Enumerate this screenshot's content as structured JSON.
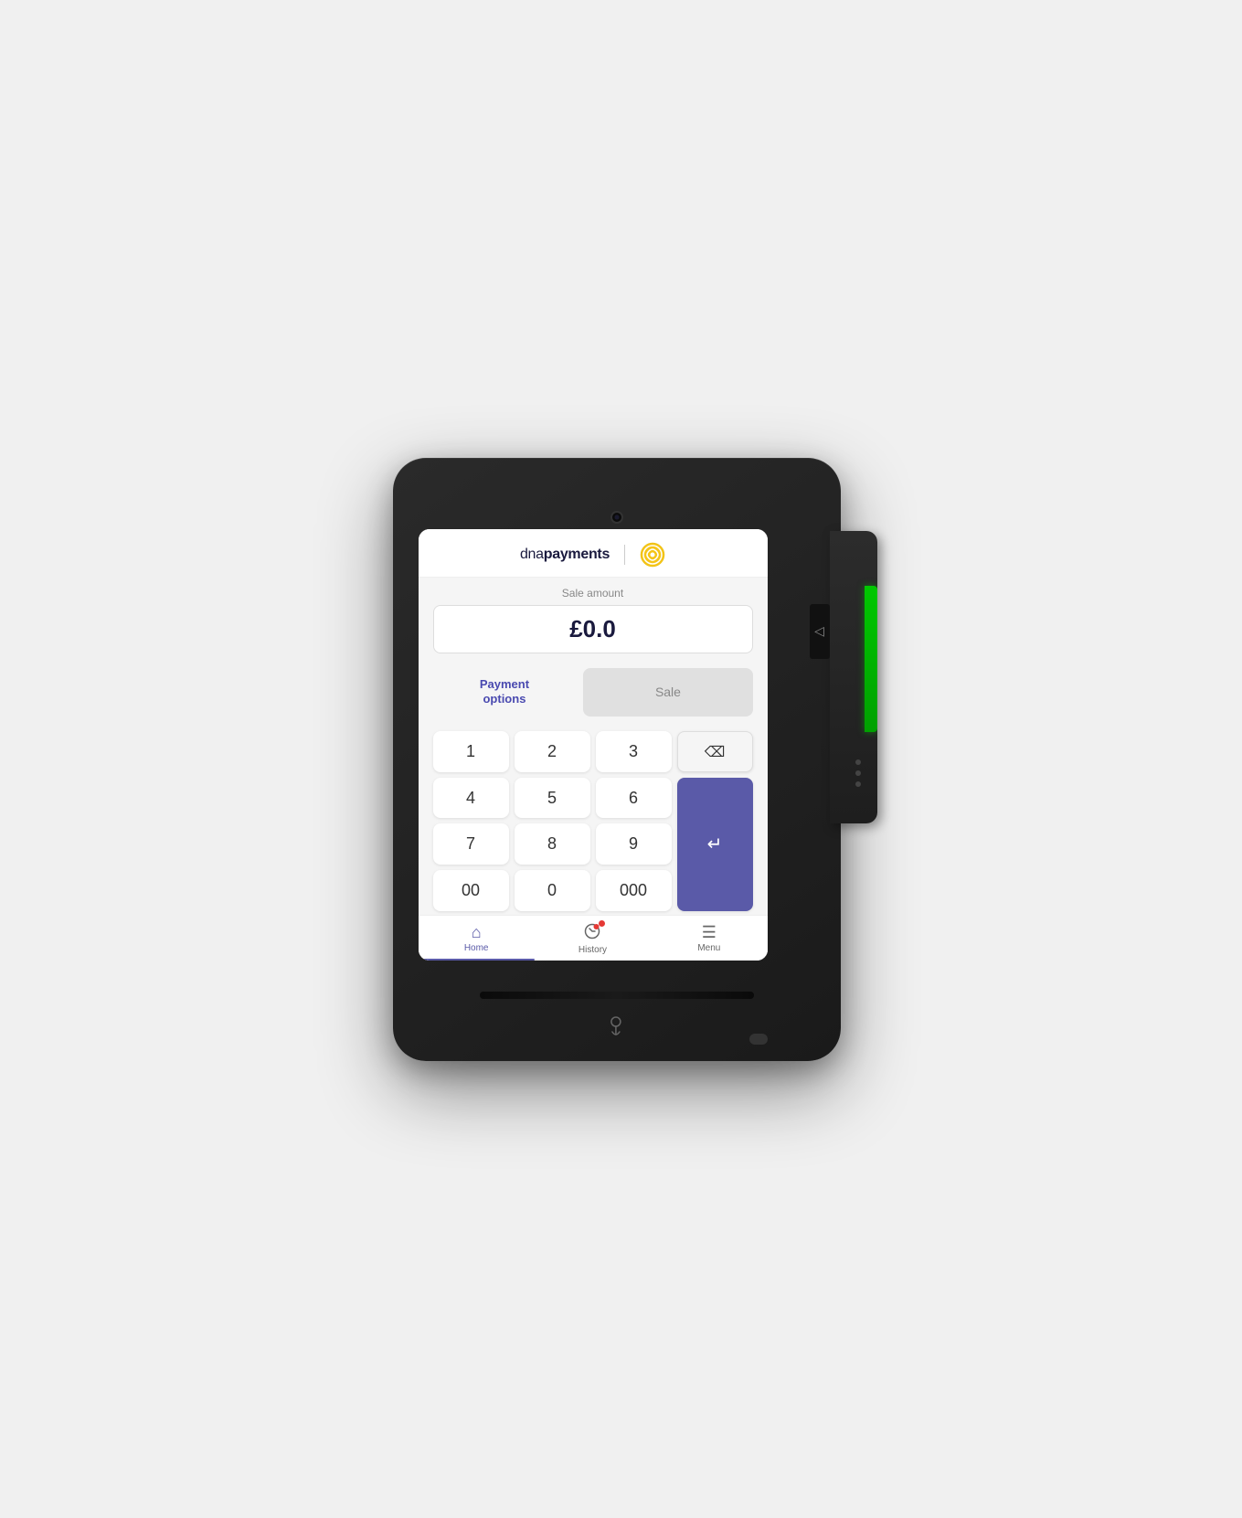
{
  "device": {
    "camera_label": "camera"
  },
  "header": {
    "logo_text_regular": "dna",
    "logo_text_bold": "payments"
  },
  "sale": {
    "label": "Sale amount",
    "amount": "£0.0"
  },
  "buttons": {
    "payment_options": "Payment\noptions",
    "sale": "Sale"
  },
  "keypad": {
    "keys": [
      "1",
      "2",
      "3",
      "4",
      "5",
      "6",
      "7",
      "8",
      "9",
      "00",
      "0",
      "000"
    ],
    "backspace_symbol": "⌫",
    "enter_symbol": "↵"
  },
  "nav": {
    "items": [
      {
        "id": "home",
        "label": "Home",
        "icon": "⌂",
        "active": true,
        "badge": false
      },
      {
        "id": "history",
        "label": "History",
        "icon": "🔍",
        "active": false,
        "badge": true
      },
      {
        "id": "menu",
        "label": "Menu",
        "icon": "☰",
        "active": false,
        "badge": false
      }
    ]
  },
  "colors": {
    "accent": "#5a5aa8",
    "active_nav": "#5a5aa8",
    "badge": "#e53935",
    "device_body": "#1a1a1a",
    "green_strip": "#00c800"
  }
}
